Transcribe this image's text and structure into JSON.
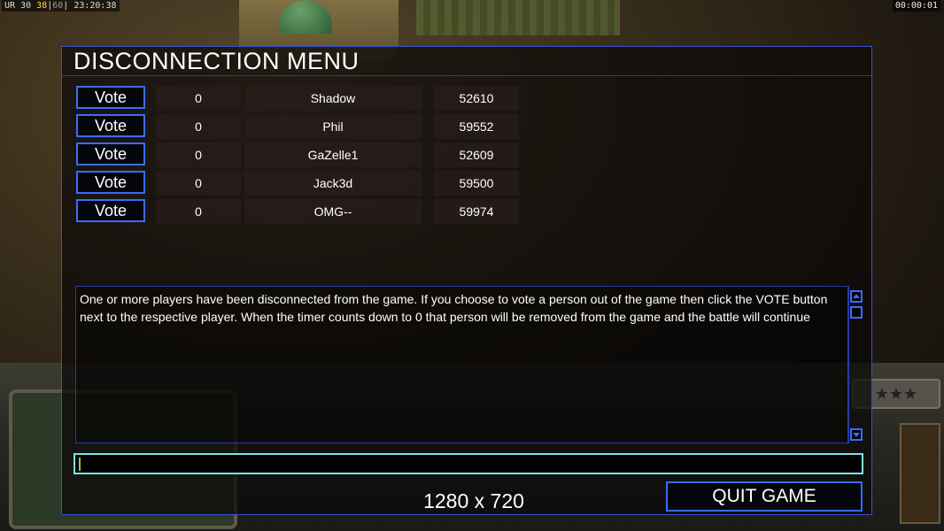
{
  "hud": {
    "stats": {
      "prefix": "UR",
      "v1": "30",
      "v2": "38",
      "v3": "60",
      "clock": "23:20:38"
    },
    "timer": "00:00:01"
  },
  "dialog": {
    "title": "DISCONNECTION MENU",
    "players": [
      {
        "vote_label": "Vote",
        "votes": "0",
        "name": "Shadow",
        "ping": "52610"
      },
      {
        "vote_label": "Vote",
        "votes": "0",
        "name": "Phil",
        "ping": "59552"
      },
      {
        "vote_label": "Vote",
        "votes": "0",
        "name": "GaZelle1",
        "ping": "52609"
      },
      {
        "vote_label": "Vote",
        "votes": "0",
        "name": "Jack3d",
        "ping": "59500"
      },
      {
        "vote_label": "Vote",
        "votes": "0",
        "name": "OMG--",
        "ping": "59974"
      }
    ],
    "message": "One or more players have been disconnected from the game. If you choose to vote a person out of the game then click the VOTE button next to the respective player. When the timer counts down to 0 that person will be removed from the game and the battle will continue",
    "chat_value": "",
    "resolution": "1280 x 720",
    "quit_label": "QUIT GAME"
  },
  "colors": {
    "accent_border": "#3b6cff",
    "chat_border": "#7fe3e6"
  }
}
